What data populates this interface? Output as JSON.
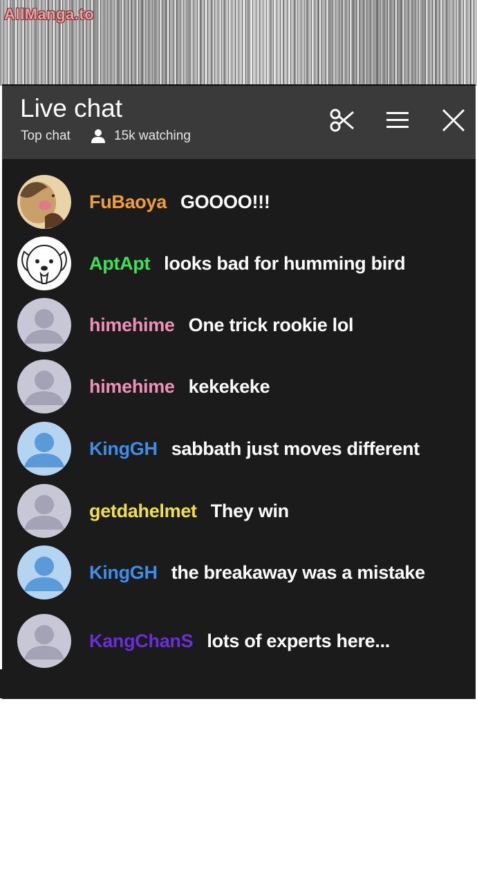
{
  "watermark": "AllManga.to",
  "chat": {
    "title": "Live chat",
    "mode": "Top chat",
    "viewers": "15k watching",
    "icons": {
      "viewer": "person-icon",
      "clip": "scissors-icon",
      "menu": "menu-icon",
      "close": "close-icon"
    },
    "messages": [
      {
        "user": "FuBaoya",
        "text": "GOOOO!!!",
        "color": "#f0a030",
        "avatar": "animal-avatar"
      },
      {
        "user": "AptApt",
        "text": "looks bad for humming bird",
        "color": "#3ee05a",
        "avatar": "dog-avatar"
      },
      {
        "user": "himehime",
        "text": "One trick rookie lol",
        "color": "#ef90b8",
        "avatar": "default-avatar"
      },
      {
        "user": "himehime",
        "text": "kekekeke",
        "color": "#ef90b8",
        "avatar": "default-avatar"
      },
      {
        "user": "KingGH",
        "text": "sabbath just moves different",
        "color": "#3d8ee8",
        "avatar": "blue-avatar"
      },
      {
        "user": "getdahelmet",
        "text": "They win",
        "color": "#f3e23a",
        "avatar": "default-avatar"
      },
      {
        "user": "KingGH",
        "text": "the breakaway was a mistake",
        "color": "#3d8ee8",
        "avatar": "blue-avatar"
      },
      {
        "user": "KangChanS",
        "text": "lots of experts here...",
        "color": "#6a2ed8",
        "avatar": "default-avatar"
      }
    ]
  }
}
